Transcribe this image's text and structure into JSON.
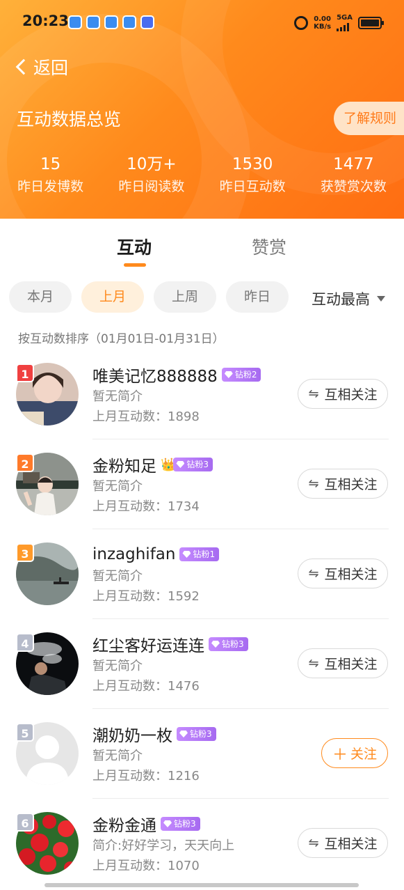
{
  "status_bar": {
    "time": "20:23",
    "speed_value": "0.00",
    "speed_unit": "KB/s",
    "network": "5GA",
    "icons": [
      "app-notification-icon",
      "alarm-icon",
      "signal-icon",
      "battery-icon"
    ]
  },
  "header": {
    "back_label": "返回",
    "title": "互动数据总览",
    "rules_button": "了解规则",
    "stats": [
      {
        "value": "15",
        "label": "昨日发博数"
      },
      {
        "value": "10万+",
        "label": "昨日阅读数"
      },
      {
        "value": "1530",
        "label": "昨日互动数"
      },
      {
        "value": "1477",
        "label": "获赞赏次数"
      }
    ],
    "gradient_colors": [
      "#ffb13a",
      "#ff8a1c",
      "#ff6d12"
    ]
  },
  "tabs": [
    {
      "label": "互动",
      "active": true
    },
    {
      "label": "赞赏",
      "active": false
    }
  ],
  "filters": [
    {
      "label": "本月",
      "active": false
    },
    {
      "label": "上月",
      "active": true
    },
    {
      "label": "上周",
      "active": false
    },
    {
      "label": "昨日",
      "active": false
    }
  ],
  "sort": {
    "label": "互动最高"
  },
  "range_text": "按互动数排序（01月01日-01月31日）",
  "accent_color": "#ff8a1c",
  "users": [
    {
      "rank": "1",
      "rank_color": "#f04040",
      "name": "唯美记忆888888",
      "crown": false,
      "badge": "钻粉2",
      "bio": "暂无简介",
      "count": "上月互动数：1898",
      "button": "互相关注",
      "button_type": "mutual",
      "avatar": "portrait"
    },
    {
      "rank": "2",
      "rank_color": "#ff7a2a",
      "name": "金粉知足",
      "crown": true,
      "badge": "钻粉3",
      "bio": "暂无简介",
      "count": "上月互动数：1734",
      "button": "互相关注",
      "button_type": "mutual",
      "avatar": "child"
    },
    {
      "rank": "3",
      "rank_color": "#ff9a2a",
      "name": "inzaghifan",
      "crown": false,
      "badge": "钻粉1",
      "bio": "暂无简介",
      "count": "上月互动数：1592",
      "button": "互相关注",
      "button_type": "mutual",
      "avatar": "lake"
    },
    {
      "rank": "4",
      "rank_color": "#b7bccb",
      "name": "红尘客好运连连",
      "crown": false,
      "badge": "钻粉3",
      "bio": "暂无简介",
      "count": "上月互动数：1476",
      "button": "互相关注",
      "button_type": "mutual",
      "avatar": "dark"
    },
    {
      "rank": "5",
      "rank_color": "#b7bccb",
      "name": "潮奶奶一枚",
      "crown": false,
      "badge": "钻粉3",
      "bio": "暂无简介",
      "count": "上月互动数：1216",
      "button": "关注",
      "button_type": "follow",
      "avatar": "default"
    },
    {
      "rank": "6",
      "rank_color": "#b7bccb",
      "name": "金粉金通",
      "crown": false,
      "badge": "钻粉3",
      "bio": "简介:好好学习，天天向上",
      "count": "上月互动数：1070",
      "button": "互相关注",
      "button_type": "mutual",
      "avatar": "flowers"
    }
  ]
}
